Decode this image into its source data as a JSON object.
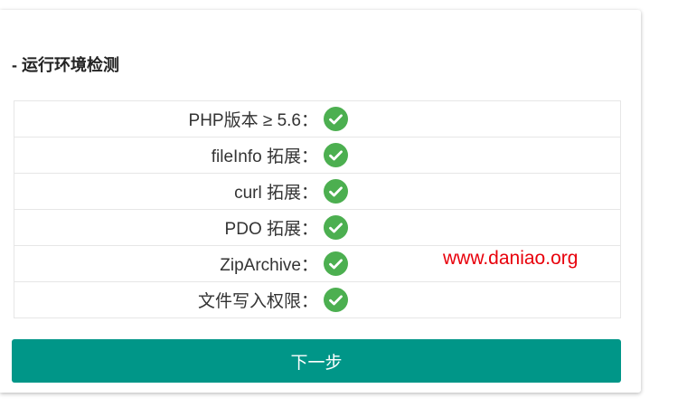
{
  "section_title": "- 运行环境检测",
  "checks": [
    {
      "label": "PHP版本 ≥ 5.6：",
      "status": "passed"
    },
    {
      "label": "fileInfo 拓展：",
      "status": "passed"
    },
    {
      "label": "curl 拓展：",
      "status": "passed"
    },
    {
      "label": "PDO 拓展：",
      "status": "passed"
    },
    {
      "label": "ZipArchive：",
      "status": "passed"
    },
    {
      "label": "文件写入权限：",
      "status": "passed"
    }
  ],
  "watermark": "www.daniao.org",
  "next_button_label": "下一步",
  "colors": {
    "check_green": "#4caf50",
    "button_teal": "#009688",
    "watermark_red": "#e8000b"
  },
  "icons": {
    "check": "check-circle-icon"
  }
}
